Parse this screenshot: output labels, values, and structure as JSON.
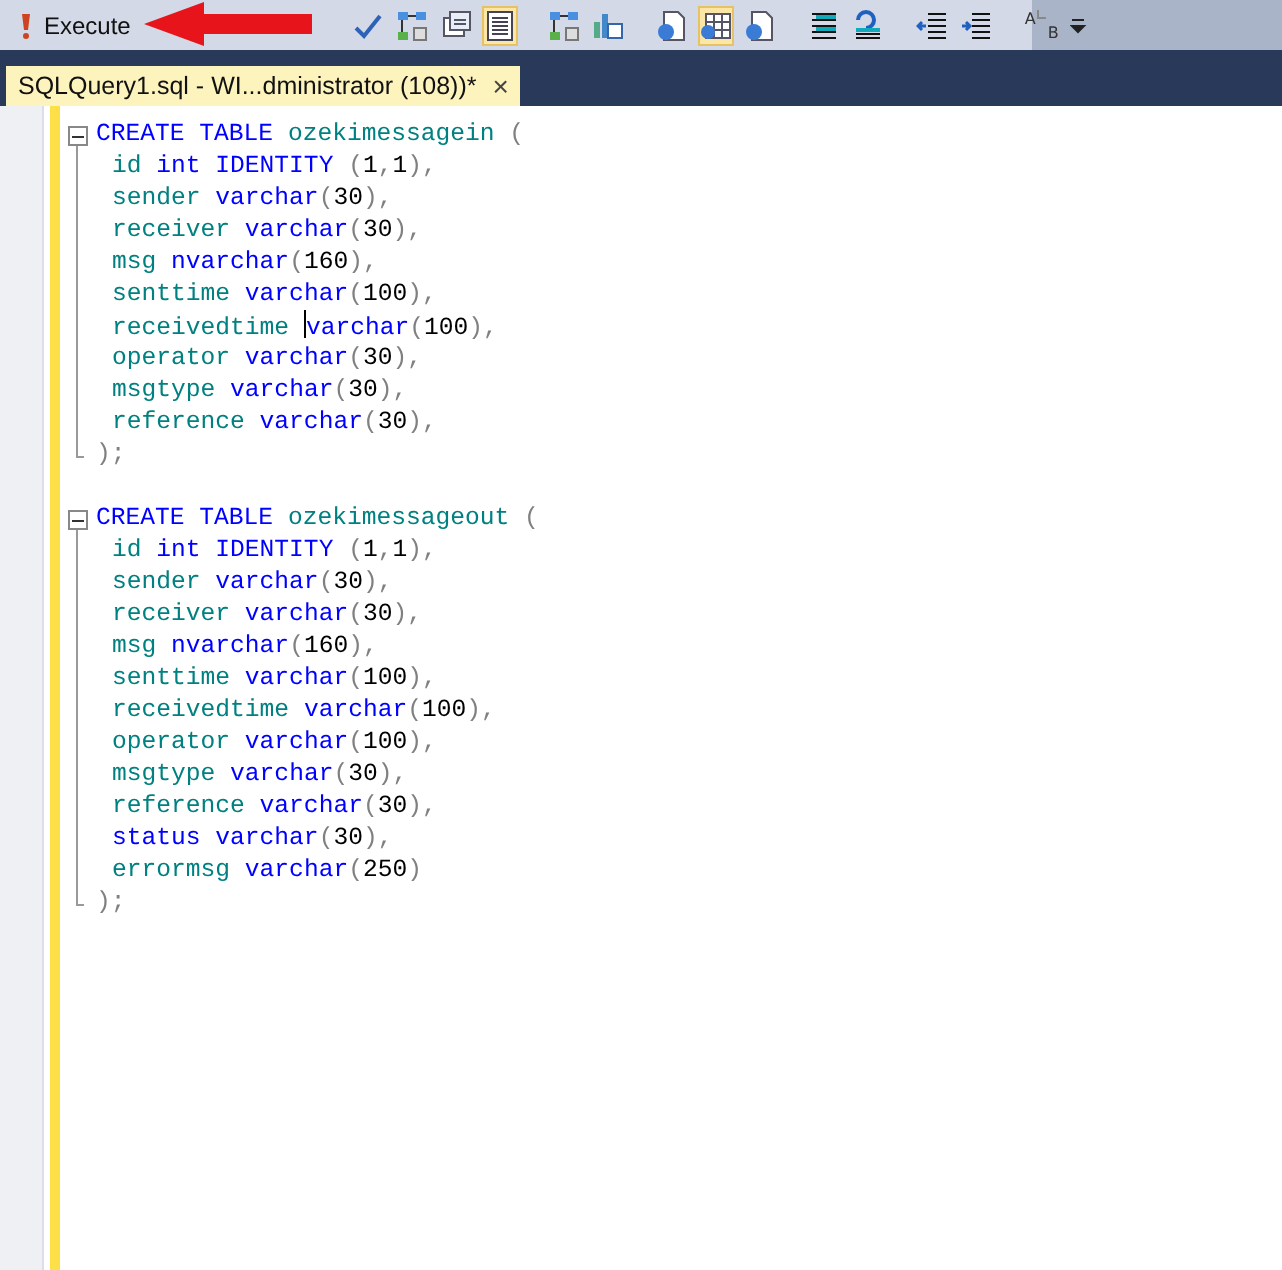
{
  "toolbar": {
    "execute_label": "Execute",
    "buttons": [
      {
        "kind": "check",
        "selected": false
      },
      {
        "kind": "plan",
        "selected": false
      },
      {
        "kind": "query-options",
        "selected": false
      },
      {
        "kind": "results-text",
        "selected": true
      },
      {
        "kind": "divider"
      },
      {
        "kind": "plan",
        "selected": false
      },
      {
        "kind": "stats",
        "selected": false
      },
      {
        "kind": "divider"
      },
      {
        "kind": "results-file",
        "selected": false
      },
      {
        "kind": "results-grid",
        "selected": true
      },
      {
        "kind": "results-file",
        "selected": false
      },
      {
        "kind": "divider"
      },
      {
        "kind": "comment",
        "selected": false
      },
      {
        "kind": "uncomment",
        "selected": false
      },
      {
        "kind": "divider"
      },
      {
        "kind": "outdent",
        "selected": false
      },
      {
        "kind": "indent",
        "selected": false
      },
      {
        "kind": "divider"
      },
      {
        "kind": "template",
        "selected": false,
        "text": "A",
        "subtext": "B"
      },
      {
        "kind": "overflow",
        "selected": false
      }
    ]
  },
  "tabs": [
    {
      "label": "SQLQuery1.sql - WI...dministrator (108))*",
      "close": "×",
      "selected": true
    }
  ],
  "editor": {
    "blocks": [
      {
        "collapsed": false,
        "lines": [
          [
            {
              "kind": "kw",
              "text": "CREATE TABLE "
            },
            {
              "kind": "id",
              "text": "ozekimessagein "
            },
            {
              "kind": "p",
              "text": "("
            }
          ],
          [
            {
              "kind": "id",
              "text": "id "
            },
            {
              "kind": "kw",
              "text": "int IDENTITY "
            },
            {
              "kind": "p",
              "text": "("
            },
            {
              "kind": "n",
              "text": "1"
            },
            {
              "kind": "p",
              "text": ","
            },
            {
              "kind": "n",
              "text": "1"
            },
            {
              "kind": "p",
              "text": "),"
            }
          ],
          [
            {
              "kind": "id",
              "text": "sender "
            },
            {
              "kind": "kw",
              "text": "varchar"
            },
            {
              "kind": "p",
              "text": "("
            },
            {
              "kind": "n",
              "text": "30"
            },
            {
              "kind": "p",
              "text": "),"
            }
          ],
          [
            {
              "kind": "id",
              "text": "receiver "
            },
            {
              "kind": "kw",
              "text": "varchar"
            },
            {
              "kind": "p",
              "text": "("
            },
            {
              "kind": "n",
              "text": "30"
            },
            {
              "kind": "p",
              "text": "),"
            }
          ],
          [
            {
              "kind": "id",
              "text": "msg "
            },
            {
              "kind": "kw",
              "text": "nvarchar"
            },
            {
              "kind": "p",
              "text": "("
            },
            {
              "kind": "n",
              "text": "160"
            },
            {
              "kind": "p",
              "text": "),"
            }
          ],
          [
            {
              "kind": "id",
              "text": "senttime "
            },
            {
              "kind": "kw",
              "text": "varchar"
            },
            {
              "kind": "p",
              "text": "("
            },
            {
              "kind": "n",
              "text": "100"
            },
            {
              "kind": "p",
              "text": "),"
            }
          ],
          [
            {
              "kind": "id",
              "text": "receivedtime "
            },
            {
              "kind": "caret"
            },
            {
              "kind": "kw",
              "text": "varchar"
            },
            {
              "kind": "p",
              "text": "("
            },
            {
              "kind": "n",
              "text": "100"
            },
            {
              "kind": "p",
              "text": "),"
            }
          ],
          [
            {
              "kind": "id",
              "text": "operator "
            },
            {
              "kind": "kw",
              "text": "varchar"
            },
            {
              "kind": "p",
              "text": "("
            },
            {
              "kind": "n",
              "text": "30"
            },
            {
              "kind": "p",
              "text": "),"
            }
          ],
          [
            {
              "kind": "id",
              "text": "msgtype "
            },
            {
              "kind": "kw",
              "text": "varchar"
            },
            {
              "kind": "p",
              "text": "("
            },
            {
              "kind": "n",
              "text": "30"
            },
            {
              "kind": "p",
              "text": "),"
            }
          ],
          [
            {
              "kind": "id",
              "text": "reference "
            },
            {
              "kind": "kw",
              "text": "varchar"
            },
            {
              "kind": "p",
              "text": "("
            },
            {
              "kind": "n",
              "text": "30"
            },
            {
              "kind": "p",
              "text": "),"
            }
          ],
          [
            {
              "kind": "p",
              "text": ");"
            }
          ]
        ]
      },
      {
        "collapsed": false,
        "lines": [
          [
            {
              "kind": "kw",
              "text": "CREATE TABLE "
            },
            {
              "kind": "id",
              "text": "ozekimessageout "
            },
            {
              "kind": "p",
              "text": "("
            }
          ],
          [
            {
              "kind": "id",
              "text": "id "
            },
            {
              "kind": "kw",
              "text": "int IDENTITY "
            },
            {
              "kind": "p",
              "text": "("
            },
            {
              "kind": "n",
              "text": "1"
            },
            {
              "kind": "p",
              "text": ","
            },
            {
              "kind": "n",
              "text": "1"
            },
            {
              "kind": "p",
              "text": "),"
            }
          ],
          [
            {
              "kind": "id",
              "text": "sender "
            },
            {
              "kind": "kw",
              "text": "varchar"
            },
            {
              "kind": "p",
              "text": "("
            },
            {
              "kind": "n",
              "text": "30"
            },
            {
              "kind": "p",
              "text": "),"
            }
          ],
          [
            {
              "kind": "id",
              "text": "receiver "
            },
            {
              "kind": "kw",
              "text": "varchar"
            },
            {
              "kind": "p",
              "text": "("
            },
            {
              "kind": "n",
              "text": "30"
            },
            {
              "kind": "p",
              "text": "),"
            }
          ],
          [
            {
              "kind": "id",
              "text": "msg "
            },
            {
              "kind": "kw",
              "text": "nvarchar"
            },
            {
              "kind": "p",
              "text": "("
            },
            {
              "kind": "n",
              "text": "160"
            },
            {
              "kind": "p",
              "text": "),"
            }
          ],
          [
            {
              "kind": "id",
              "text": "senttime "
            },
            {
              "kind": "kw",
              "text": "varchar"
            },
            {
              "kind": "p",
              "text": "("
            },
            {
              "kind": "n",
              "text": "100"
            },
            {
              "kind": "p",
              "text": "),"
            }
          ],
          [
            {
              "kind": "id",
              "text": "receivedtime "
            },
            {
              "kind": "kw",
              "text": "varchar"
            },
            {
              "kind": "p",
              "text": "("
            },
            {
              "kind": "n",
              "text": "100"
            },
            {
              "kind": "p",
              "text": "),"
            }
          ],
          [
            {
              "kind": "id",
              "text": "operator "
            },
            {
              "kind": "kw",
              "text": "varchar"
            },
            {
              "kind": "p",
              "text": "("
            },
            {
              "kind": "n",
              "text": "100"
            },
            {
              "kind": "p",
              "text": "),"
            }
          ],
          [
            {
              "kind": "id",
              "text": "msgtype "
            },
            {
              "kind": "kw",
              "text": "varchar"
            },
            {
              "kind": "p",
              "text": "("
            },
            {
              "kind": "n",
              "text": "30"
            },
            {
              "kind": "p",
              "text": "),"
            }
          ],
          [
            {
              "kind": "id",
              "text": "reference "
            },
            {
              "kind": "kw",
              "text": "varchar"
            },
            {
              "kind": "p",
              "text": "("
            },
            {
              "kind": "n",
              "text": "30"
            },
            {
              "kind": "p",
              "text": "),"
            }
          ],
          [
            {
              "kind": "kw",
              "text": "status "
            },
            {
              "kind": "kw",
              "text": "varchar"
            },
            {
              "kind": "p",
              "text": "("
            },
            {
              "kind": "n",
              "text": "30"
            },
            {
              "kind": "p",
              "text": "),"
            }
          ],
          [
            {
              "kind": "id",
              "text": "errormsg "
            },
            {
              "kind": "kw",
              "text": "varchar"
            },
            {
              "kind": "p",
              "text": "("
            },
            {
              "kind": "n",
              "text": "250"
            },
            {
              "kind": "p",
              "text": ")"
            }
          ],
          [
            {
              "kind": "p",
              "text": ");"
            }
          ]
        ]
      }
    ]
  }
}
